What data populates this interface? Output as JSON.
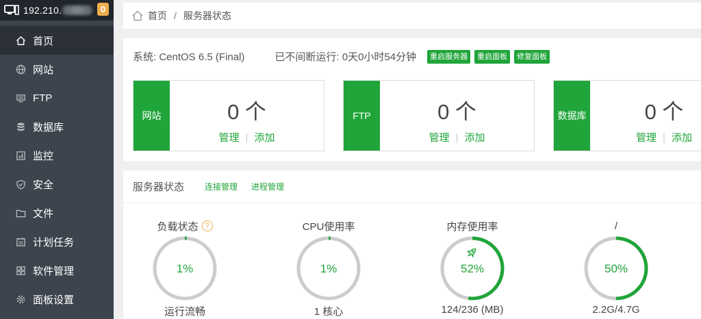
{
  "header": {
    "ip": "192.210.",
    "badge": "0"
  },
  "sidebar": {
    "items": [
      {
        "label": "首页",
        "icon": "home-icon",
        "active": true
      },
      {
        "label": "网站",
        "icon": "globe-icon"
      },
      {
        "label": "FTP",
        "icon": "ftp-icon"
      },
      {
        "label": "数据库",
        "icon": "database-icon"
      },
      {
        "label": "监控",
        "icon": "monitor-chart-icon"
      },
      {
        "label": "安全",
        "icon": "shield-icon"
      },
      {
        "label": "文件",
        "icon": "folder-icon"
      },
      {
        "label": "计划任务",
        "icon": "calendar-icon"
      },
      {
        "label": "软件管理",
        "icon": "grid-icon"
      },
      {
        "label": "面板设置",
        "icon": "gear-icon"
      }
    ]
  },
  "breadcrumb": {
    "home": "首页",
    "sep": "/",
    "current": "服务器状态"
  },
  "system": {
    "os": "系统: CentOS 6.5 (Final)",
    "uptime": "已不间断运行: 0天0小时54分钟",
    "buttons": [
      "重启服务器",
      "重启面板",
      "修复面板"
    ]
  },
  "stats": [
    {
      "label": "网站",
      "count": "0 个",
      "manage": "管理",
      "sep": "|",
      "add": "添加"
    },
    {
      "label": "FTP",
      "count": "0 个",
      "manage": "管理",
      "sep": "|",
      "add": "添加"
    },
    {
      "label": "数据库",
      "count": "0 个",
      "manage": "管理",
      "sep": "|",
      "add": "添加"
    }
  ],
  "status": {
    "title": "服务器状态",
    "links": [
      "连接管理",
      "进程管理"
    ],
    "help": "?",
    "gauges": [
      {
        "title": "负载状态",
        "percent": 1,
        "value": "1%",
        "bottom": "运行流畅"
      },
      {
        "title": "CPU使用率",
        "percent": 1,
        "value": "1%",
        "bottom": "1 核心"
      },
      {
        "title": "内存使用率",
        "percent": 52,
        "value": "52%",
        "bottom": "124/236 (MB)"
      },
      {
        "title": "/",
        "percent": 50,
        "value": "50%",
        "bottom": "2.2G/4.7G"
      }
    ]
  },
  "colors": {
    "accent": "#20a53a",
    "sidebar": "#3c444d",
    "sidebar_head": "#20262c",
    "badge": "#f0ad4e",
    "ring": "#cccccc"
  }
}
